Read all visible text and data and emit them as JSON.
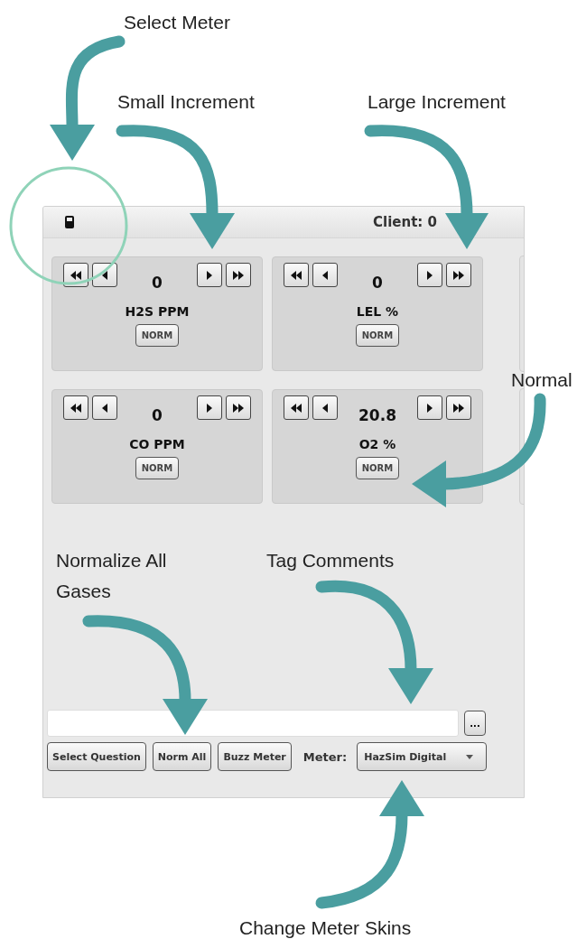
{
  "annotations": [
    {
      "text": "Select Meter"
    },
    {
      "text": "Small Increment"
    },
    {
      "text": "Large Increment"
    },
    {
      "text": "Normal"
    },
    {
      "text": "Normalize All Gases"
    },
    {
      "text": "Tag Comments"
    },
    {
      "text": "Change Meter Skins"
    }
  ],
  "window": {
    "client_label": "Client: 0"
  },
  "gauges": [
    {
      "value": "0",
      "label": "H2S PPM",
      "norm_button": "NORM"
    },
    {
      "value": "0",
      "label": "LEL %",
      "norm_button": "NORM"
    },
    {
      "value": "0",
      "label": "CO PPM",
      "norm_button": "NORM"
    },
    {
      "value": "20.8",
      "label": "O2 %",
      "norm_button": "NORM"
    }
  ],
  "more_button": "...",
  "buttons": [
    "Select Question",
    "Norm All",
    "Buzz Meter"
  ],
  "meter": {
    "label": "Meter:",
    "value": "HazSim Digital"
  }
}
